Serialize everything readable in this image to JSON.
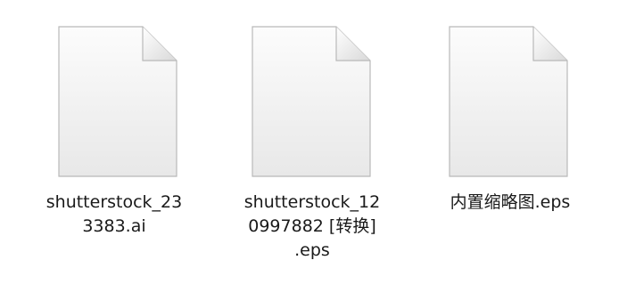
{
  "files": [
    {
      "name_display": "shutterstock_23\n3383.ai",
      "icon": "generic-document-icon"
    },
    {
      "name_display": "shutterstock_12\n0997882 [转换]\n.eps",
      "icon": "generic-document-icon"
    },
    {
      "name_display": "内置缩略图.eps",
      "icon": "generic-document-icon"
    }
  ],
  "colors": {
    "background": "#ffffff",
    "page_fill_top": "#fbfbfb",
    "page_fill_bottom": "#e9e9e9",
    "page_border": "#b9b9b9",
    "text": "#1a1a1a"
  }
}
